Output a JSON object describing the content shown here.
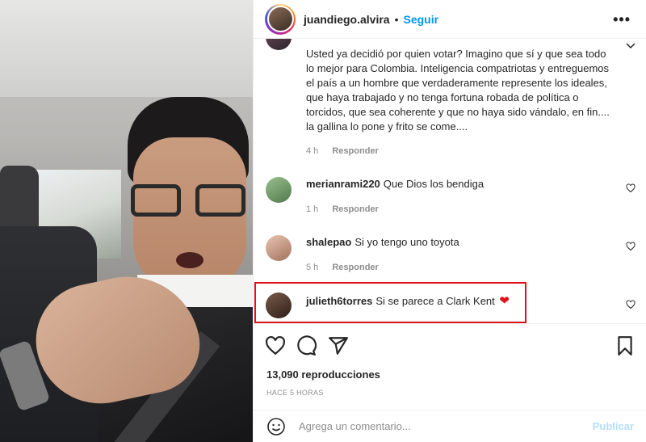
{
  "header": {
    "username": "juandiego.alvira",
    "separator": "•",
    "follow_label": "Seguir",
    "more_label": "•••",
    "avatar_icon": "profile-avatar"
  },
  "comments": [
    {
      "username": "",
      "text": "Usted ya decidió por quien votar? Imagino que sí y que sea todo lo mejor para Colombia. Inteligencia compatriotas y entreguemos el país a un hombre que verdaderamente represente los ideales, que haya trabajado y no tenga fortuna robada de política o torcidos, que sea coherente y que no haya sido vándalo, en fin.... la gallina lo pone y frito se come....",
      "time": "4 h",
      "reply": "Responder"
    },
    {
      "username": "merianrami220",
      "text": "Que Dios los bendiga",
      "time": "1 h",
      "reply": "Responder"
    },
    {
      "username": "shalepao",
      "text": "Si yo tengo uno toyota",
      "time": "5 h",
      "reply": "Responder"
    },
    {
      "username": "julieth6torres",
      "text": "Si se parece a Clark Kent",
      "emoji": "❤"
    }
  ],
  "stats": {
    "views": "13,090 reproducciones",
    "posted": "HACE 5 HORAS"
  },
  "add_comment": {
    "placeholder": "Agrega un comentario...",
    "publish_label": "Publicar"
  },
  "colors": {
    "link_blue": "#0095f6",
    "highlight_red": "#e0121b",
    "heart_red": "#ed4956",
    "muted_gray": "#8e8e8e"
  }
}
